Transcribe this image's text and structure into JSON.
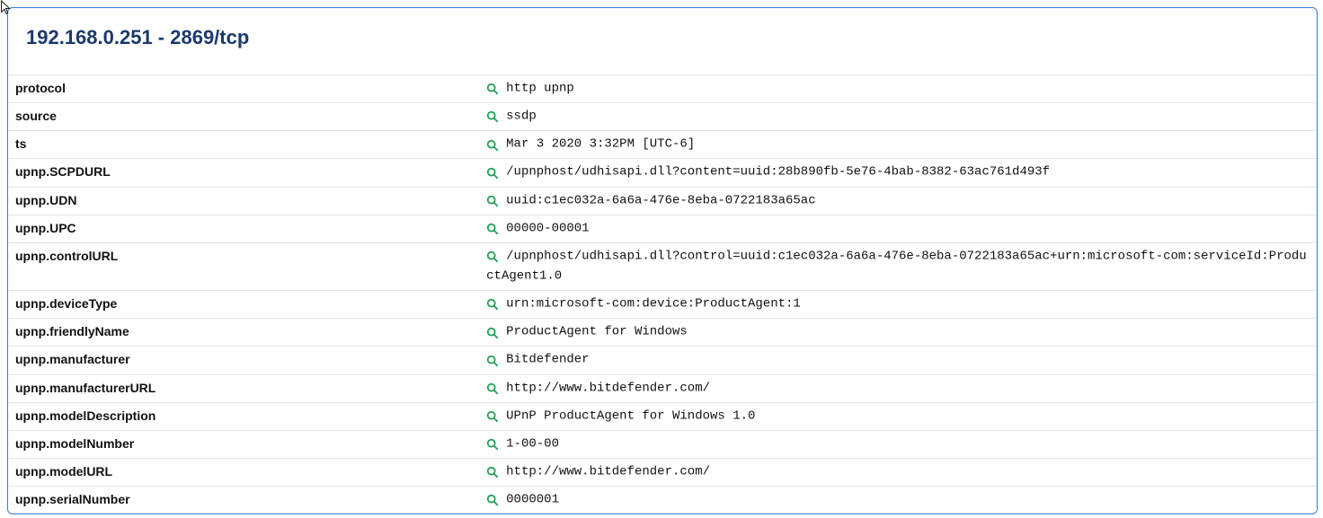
{
  "title": "192.168.0.251 - 2869/tcp",
  "rows": [
    {
      "key": "protocol",
      "value": "http upnp"
    },
    {
      "key": "source",
      "value": "ssdp"
    },
    {
      "key": "ts",
      "value": "Mar 3 2020 3:32PM [UTC-6]"
    },
    {
      "key": "upnp.SCPDURL",
      "value": "/upnphost/udhisapi.dll?content=uuid:28b890fb-5e76-4bab-8382-63ac761d493f"
    },
    {
      "key": "upnp.UDN",
      "value": "uuid:c1ec032a-6a6a-476e-8eba-0722183a65ac"
    },
    {
      "key": "upnp.UPC",
      "value": "00000-00001"
    },
    {
      "key": "upnp.controlURL",
      "value": "/upnphost/udhisapi.dll?control=uuid:c1ec032a-6a6a-476e-8eba-0722183a65ac+urn:microsoft-com:serviceId:ProductAgent1.0"
    },
    {
      "key": "upnp.deviceType",
      "value": "urn:microsoft-com:device:ProductAgent:1"
    },
    {
      "key": "upnp.friendlyName",
      "value": "ProductAgent for Windows"
    },
    {
      "key": "upnp.manufacturer",
      "value": "Bitdefender"
    },
    {
      "key": "upnp.manufacturerURL",
      "value": "http://www.bitdefender.com/"
    },
    {
      "key": "upnp.modelDescription",
      "value": "UPnP ProductAgent for Windows 1.0"
    },
    {
      "key": "upnp.modelNumber",
      "value": "1-00-00"
    },
    {
      "key": "upnp.modelURL",
      "value": "http://www.bitdefender.com/"
    },
    {
      "key": "upnp.serialNumber",
      "value": "0000001"
    }
  ]
}
